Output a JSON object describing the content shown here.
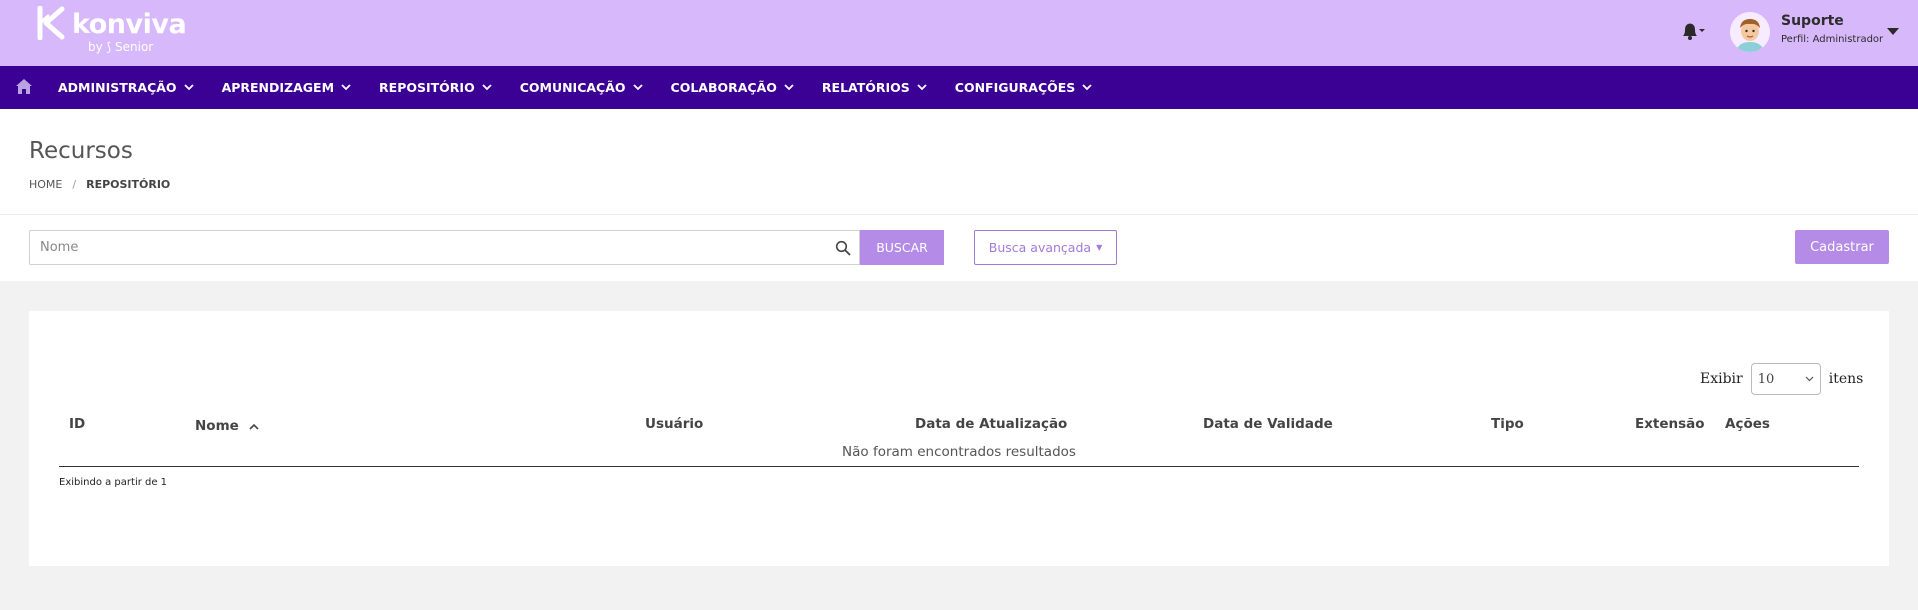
{
  "header": {
    "brand": "konviva",
    "brand_sub": "by ⟆ Senior",
    "user": {
      "name": "Suporte",
      "role": "Perfil: Administrador"
    }
  },
  "nav": {
    "items": [
      {
        "label": "ADMINISTRAÇÃO"
      },
      {
        "label": "APRENDIZAGEM"
      },
      {
        "label": "REPOSITÓRIO"
      },
      {
        "label": "COMUNICAÇÃO"
      },
      {
        "label": "COLABORAÇÃO"
      },
      {
        "label": "RELATÓRIOS"
      },
      {
        "label": "CONFIGURAÇÕES"
      }
    ]
  },
  "page": {
    "title": "Recursos",
    "breadcrumb": {
      "home": "HOME",
      "sep": "/",
      "current": "REPOSITÓRIO"
    }
  },
  "search": {
    "placeholder": "Nome",
    "value": "",
    "button_label": "BUSCAR",
    "advanced_label": "Busca avançada",
    "create_label": "Cadastrar"
  },
  "table": {
    "page_size_prefix": "Exibir",
    "page_size_value": "10",
    "page_size_suffix": "itens",
    "columns": {
      "id": "ID",
      "nome": "Nome",
      "usuario": "Usuário",
      "data_atualizacao": "Data de Atualização",
      "data_validade": "Data de Validade",
      "tipo": "Tipo",
      "extensao": "Extensão",
      "acoes": "Ações"
    },
    "empty_message": "Não foram encontrados resultados",
    "footer": "Exibindo a partir de 1"
  },
  "colors": {
    "header_bg": "#d6b8fb",
    "nav_bg": "#3b0094",
    "accent": "#b48be6"
  }
}
